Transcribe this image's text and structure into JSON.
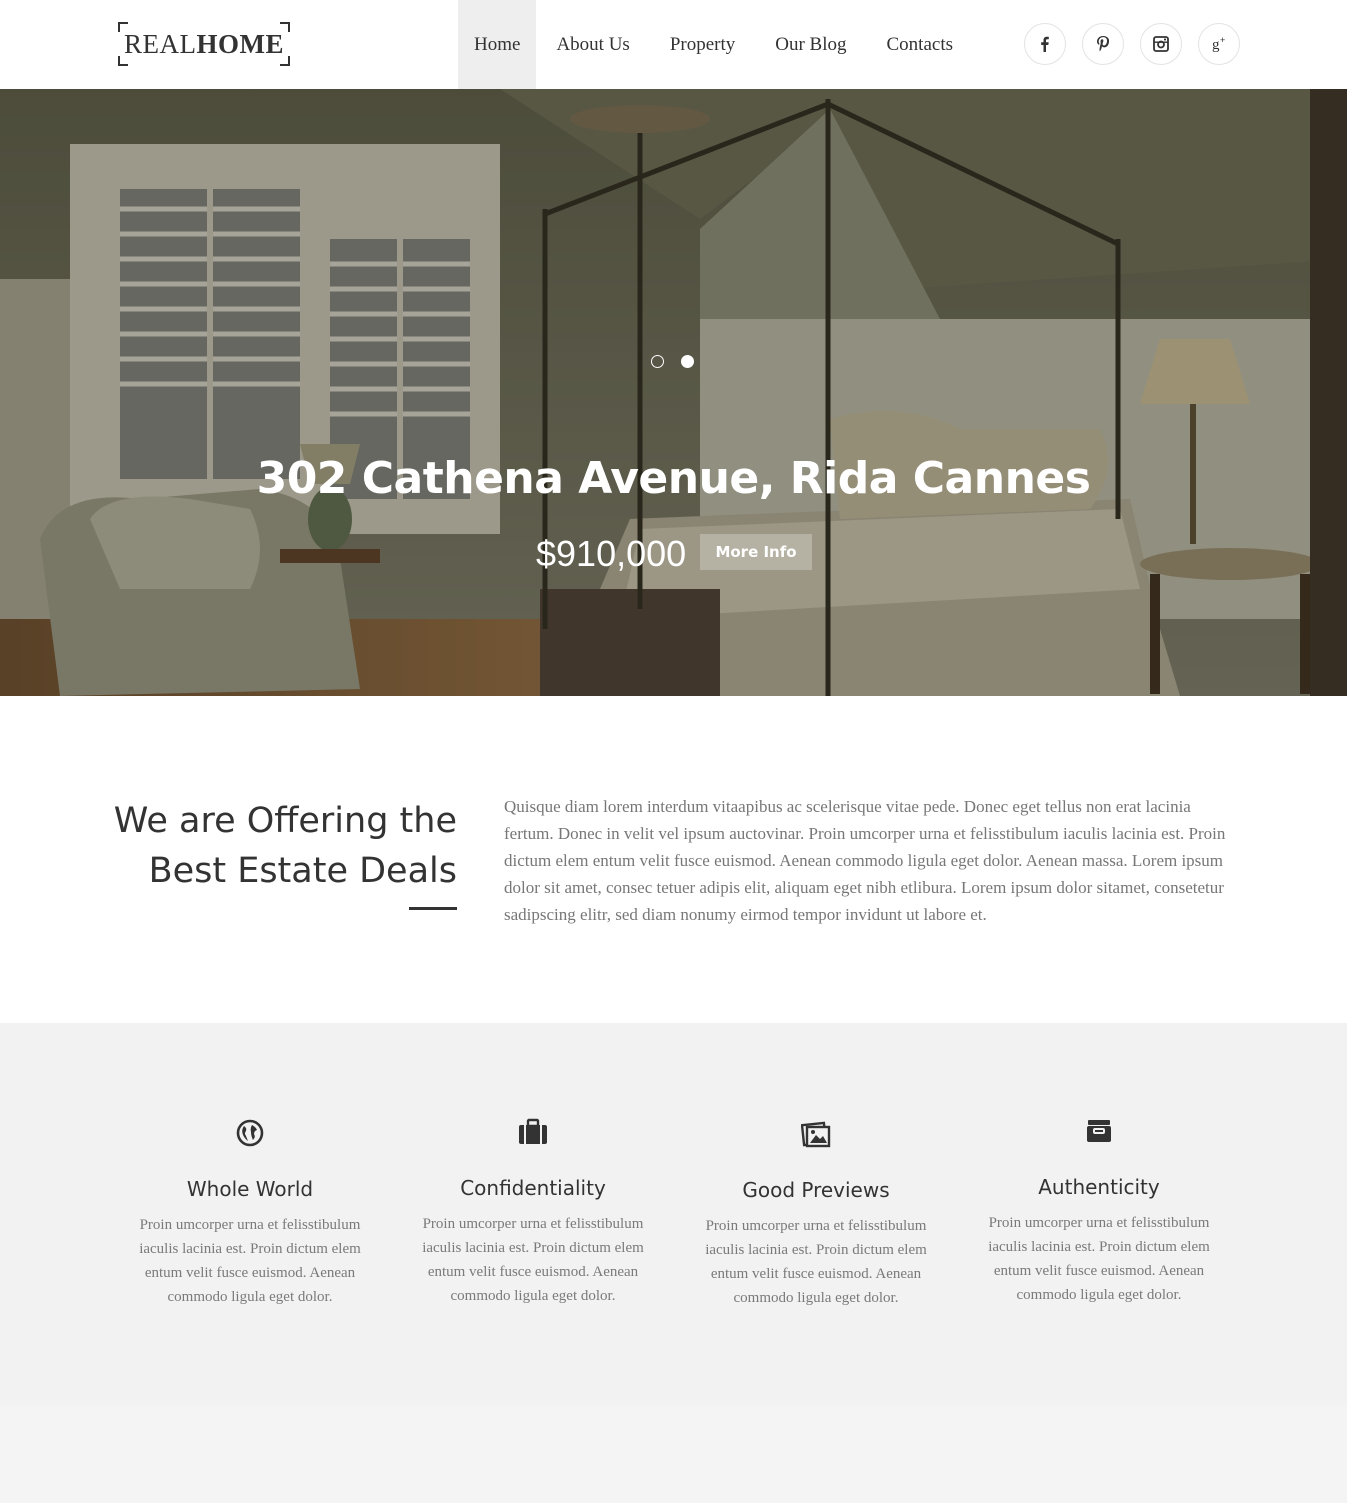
{
  "logo": {
    "light": "REAL",
    "bold": "HOME"
  },
  "nav": [
    {
      "label": "Home",
      "active": true
    },
    {
      "label": "About Us"
    },
    {
      "label": "Property"
    },
    {
      "label": "Our Blog"
    },
    {
      "label": "Contacts"
    }
  ],
  "social": [
    "facebook-icon",
    "pinterest-icon",
    "instagram-icon",
    "google-plus-icon"
  ],
  "hero": {
    "title": "302 Cathena Avenue, Rida Cannes",
    "price": "$910,000",
    "button": "More Info",
    "slides": 2,
    "active_slide": 2
  },
  "intro": {
    "title_line1": "We are Offering the",
    "title_line2": "Best Estate Deals",
    "text": "Quisque diam lorem interdum vitaapibus ac scelerisque vitae pede. Donec eget tellus non erat lacinia fertum. Donec in velit vel ipsum auctovinar. Proin umcorper urna et felisstibulum iaculis lacinia est. Proin dictum elem entum velit fusce euismod. Aenean commodo ligula eget dolor. Aenean massa. Lorem ipsum dolor sit amet, consec tetuer adipis elit, aliquam eget nibh etlibura. Lorem ipsum dolor sitamet, consetetur sadipscing elitr, sed diam nonumy eirmod tempor invidunt ut labore et."
  },
  "features": [
    {
      "icon": "globe-icon",
      "title": "Whole World",
      "text": "Proin umcorper urna et felisstibulum iaculis lacinia est. Proin dictum elem entum velit fusce euismod. Aenean commodo ligula eget dolor."
    },
    {
      "icon": "briefcase-icon",
      "title": "Confidentiality",
      "text": "Proin umcorper urna et felisstibulum iaculis lacinia est. Proin dictum elem entum velit fusce euismod. Aenean commodo ligula eget dolor."
    },
    {
      "icon": "pictures-icon",
      "title": "Good Previews",
      "text": "Proin umcorper urna et felisstibulum iaculis lacinia est. Proin dictum elem entum velit fusce euismod. Aenean commodo ligula eget dolor."
    },
    {
      "icon": "archive-icon",
      "title": "Authenticity",
      "text": "Proin umcorper urna et felisstibulum iaculis lacinia est. Proin dictum elem entum velit fusce euismod. Aenean commodo ligula eget dolor."
    }
  ]
}
